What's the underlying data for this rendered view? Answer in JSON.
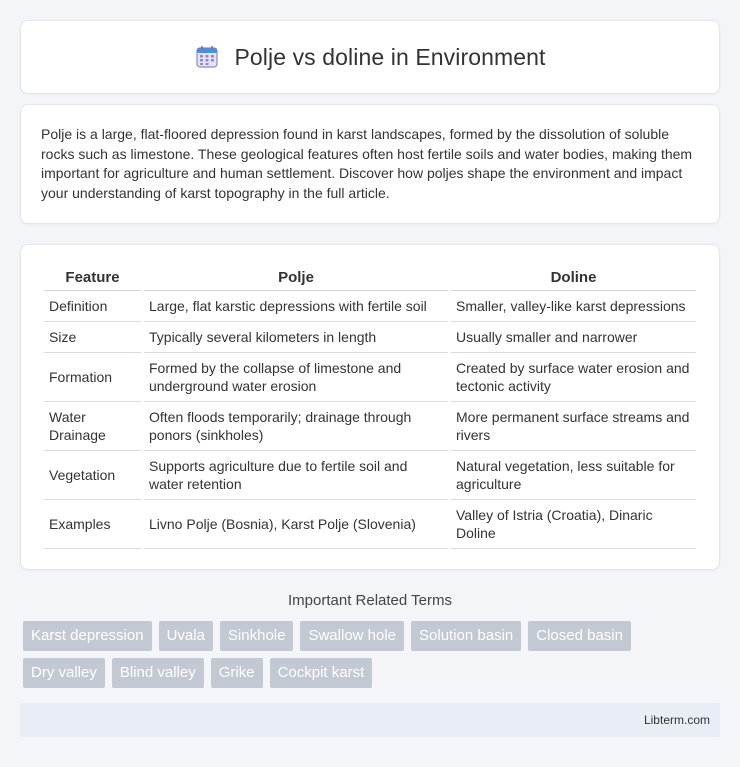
{
  "header": {
    "title": "Polje vs doline in Environment",
    "icon": "calendar-icon"
  },
  "intro": {
    "text": "Polje is a large, flat-floored depression found in karst landscapes, formed by the dissolution of soluble rocks such as limestone. These geological features often host fertile soils and water bodies, making them important for agriculture and human settlement. Discover how poljes shape the environment and impact your understanding of karst topography in the full article."
  },
  "table": {
    "headers": [
      "Feature",
      "Polje",
      "Doline"
    ],
    "rows": [
      [
        "Definition",
        "Large, flat karstic depressions with fertile soil",
        "Smaller, valley-like karst depressions"
      ],
      [
        "Size",
        "Typically several kilometers in length",
        "Usually smaller and narrower"
      ],
      [
        "Formation",
        "Formed by the collapse of limestone and underground water erosion",
        "Created by surface water erosion and tectonic activity"
      ],
      [
        "Water Drainage",
        "Often floods temporarily; drainage through ponors (sinkholes)",
        "More permanent surface streams and rivers"
      ],
      [
        "Vegetation",
        "Supports agriculture due to fertile soil and water retention",
        "Natural vegetation, less suitable for agriculture"
      ],
      [
        "Examples",
        "Livno Polje (Bosnia), Karst Polje (Slovenia)",
        "Valley of Istria (Croatia), Dinaric Doline"
      ]
    ]
  },
  "related": {
    "title": "Important Related Terms",
    "tags": [
      "Karst depression",
      "Uvala",
      "Sinkhole",
      "Swallow hole",
      "Solution basin",
      "Closed basin",
      "Dry valley",
      "Blind valley",
      "Grike",
      "Cockpit karst"
    ]
  },
  "footer": {
    "site": "Libterm.com"
  },
  "colors": {
    "tag_bg": "#c3c9d2",
    "footer_bg": "#e8edf6",
    "page_bg": "#f3f5f8"
  }
}
